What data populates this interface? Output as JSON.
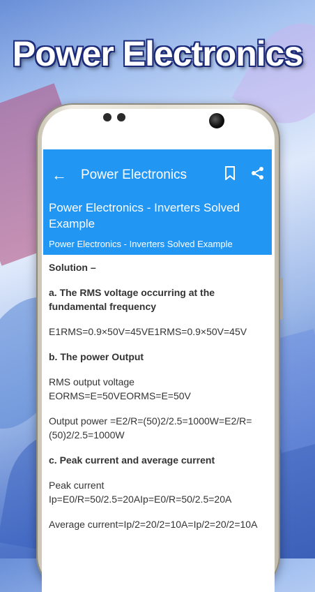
{
  "promo": {
    "title": "Power Electronics"
  },
  "app": {
    "title": "Power Electronics",
    "back_icon": "arrow-left-icon",
    "bookmark_icon": "bookmark-icon",
    "share_icon": "share-icon"
  },
  "header": {
    "title": "Power Electronics - Inverters Solved Example",
    "subtitle": "Power Electronics - Inverters Solved Example"
  },
  "content": {
    "solution": "Solution –",
    "a_heading": "a. The RMS voltage occurring at the fundamental frequency",
    "a_text": "E1RMS=0.9×50V=45VE1RMS=0.9×50V=45V",
    "b_heading": "b. The power Output",
    "b_text1": "RMS output voltage EORMS=E=50VEORMS=E=50V",
    "b_text2": "Output power =E2/R=(50)2/2.5=1000W=E2/R=(50)2/2.5=1000W",
    "c_heading": "c. Peak current and average current",
    "c_text1": "Peak current Ip=E0/R=50/2.5=20AIp=E0/R=50/2.5=20A",
    "c_text2": "Average current=Ip/2=20/2=10A=Ip/2=20/2=10A"
  }
}
